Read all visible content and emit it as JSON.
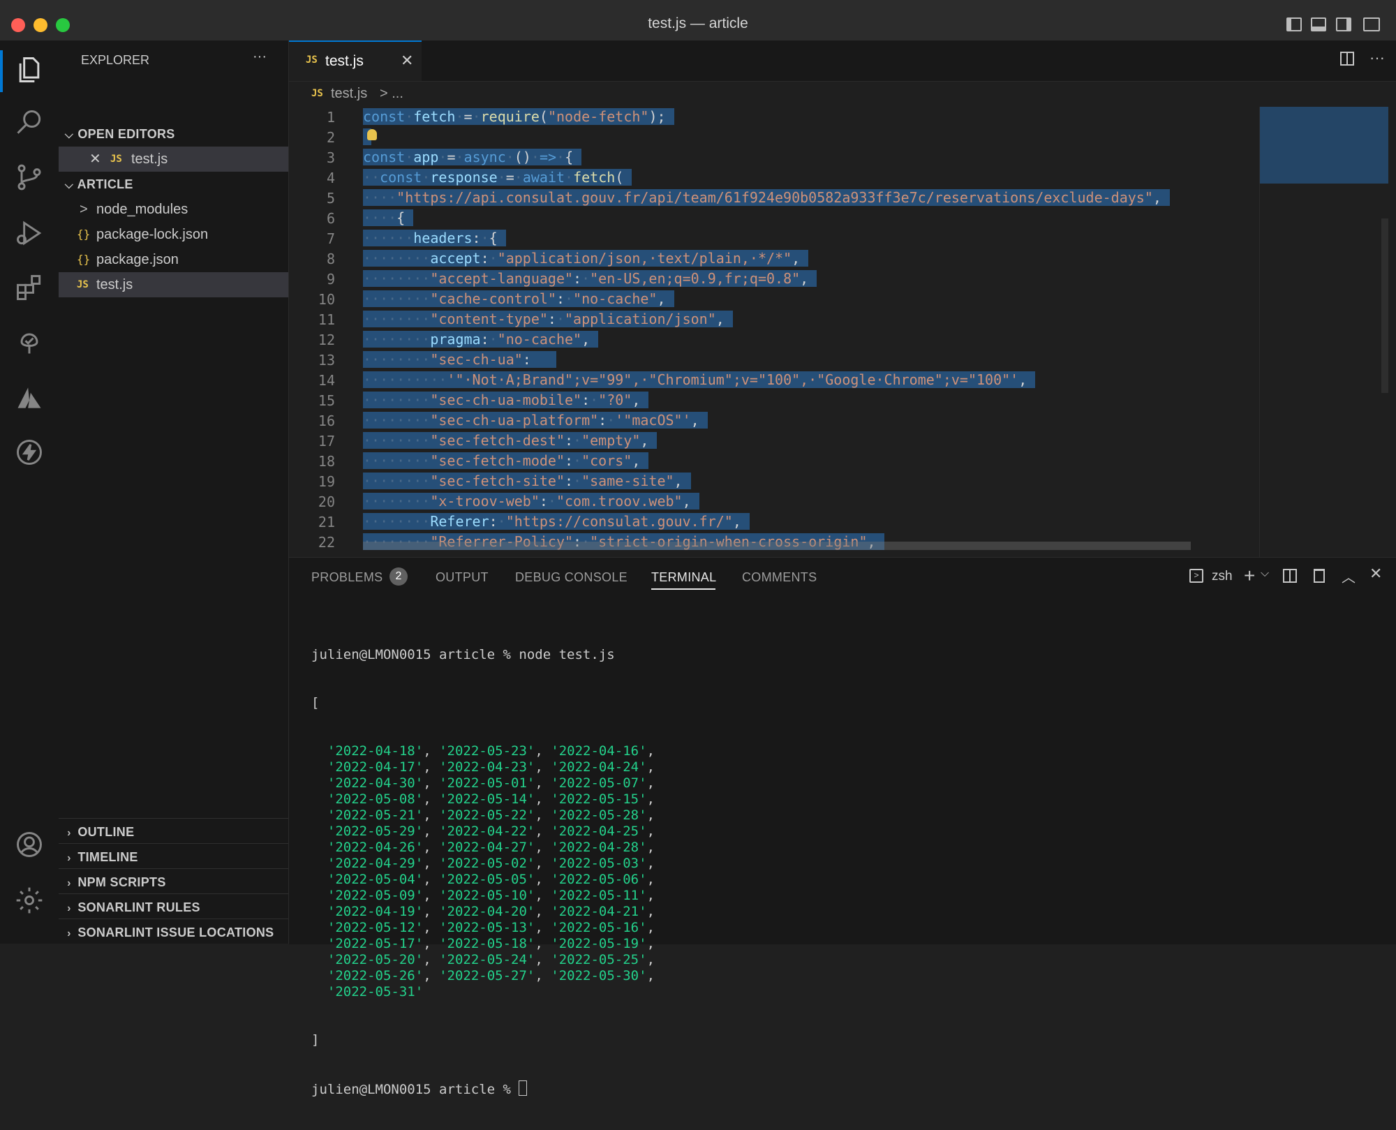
{
  "window": {
    "title": "test.js — article"
  },
  "activity_bar": {
    "items": [
      "explorer-icon",
      "search-icon",
      "source-control-icon",
      "run-debug-icon",
      "extensions-icon",
      "tree-icon",
      "azure-icon",
      "lightning-icon"
    ],
    "bottom": [
      "account-icon",
      "settings-gear-icon"
    ]
  },
  "sidebar": {
    "title": "EXPLORER",
    "more": "···",
    "open_editors_label": "OPEN EDITORS",
    "open_editors": [
      {
        "badge": "JS",
        "name": "test.js"
      }
    ],
    "folder_label": "ARTICLE",
    "files": [
      {
        "icon": ">",
        "name": "node_modules"
      },
      {
        "icon": "{}",
        "name": "package-lock.json"
      },
      {
        "icon": "{}",
        "name": "package.json"
      },
      {
        "icon": "JS",
        "name": "test.js"
      }
    ],
    "bottom_sections": [
      "OUTLINE",
      "TIMELINE",
      "NPM SCRIPTS",
      "SONARLINT RULES",
      "SONARLINT ISSUE LOCATIONS"
    ]
  },
  "editor": {
    "tab_badge": "JS",
    "tab_label": "test.js",
    "breadcrumb_file": "test.js",
    "breadcrumb_rest": "> ...",
    "line_numbers": [
      "1",
      "2",
      "3",
      "4",
      "5",
      "6",
      "7",
      "8",
      "9",
      "10",
      "11",
      "12",
      "13",
      "14",
      "15",
      "16",
      "17",
      "18",
      "19",
      "20",
      "21",
      "22"
    ]
  },
  "panel": {
    "tabs": [
      "PROBLEMS",
      "OUTPUT",
      "DEBUG CONSOLE",
      "TERMINAL",
      "COMMENTS"
    ],
    "problems_count": "2",
    "shell": "zsh",
    "terminal": {
      "command_line": "julien@LMON0015 article % node test.js",
      "open_bracket": "[",
      "dates": [
        [
          "2022-04-18",
          "2022-05-23",
          "2022-04-16"
        ],
        [
          "2022-04-17",
          "2022-04-23",
          "2022-04-24"
        ],
        [
          "2022-04-30",
          "2022-05-01",
          "2022-05-07"
        ],
        [
          "2022-05-08",
          "2022-05-14",
          "2022-05-15"
        ],
        [
          "2022-05-21",
          "2022-05-22",
          "2022-05-28"
        ],
        [
          "2022-05-29",
          "2022-04-22",
          "2022-04-25"
        ],
        [
          "2022-04-26",
          "2022-04-27",
          "2022-04-28"
        ],
        [
          "2022-04-29",
          "2022-05-02",
          "2022-05-03"
        ],
        [
          "2022-05-04",
          "2022-05-05",
          "2022-05-06"
        ],
        [
          "2022-05-09",
          "2022-05-10",
          "2022-05-11"
        ],
        [
          "2022-04-19",
          "2022-04-20",
          "2022-04-21"
        ],
        [
          "2022-05-12",
          "2022-05-13",
          "2022-05-16"
        ],
        [
          "2022-05-17",
          "2022-05-18",
          "2022-05-19"
        ],
        [
          "2022-05-20",
          "2022-05-24",
          "2022-05-25"
        ],
        [
          "2022-05-26",
          "2022-05-27",
          "2022-05-30"
        ],
        [
          "2022-05-31"
        ]
      ],
      "close_bracket": "]",
      "prompt": "julien@LMON0015 article %"
    }
  }
}
